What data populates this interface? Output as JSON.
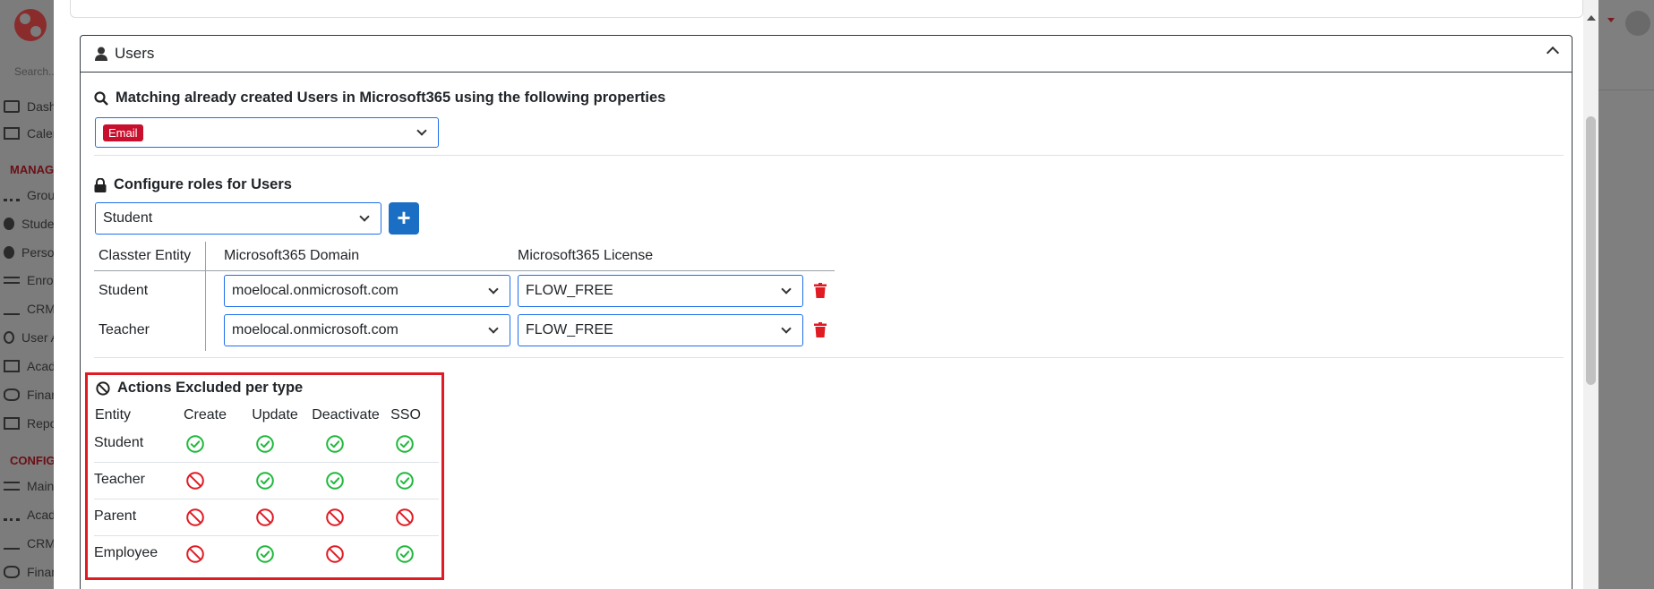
{
  "app": {
    "search_placeholder": "Search...",
    "nav": [
      {
        "label": "Dashboard",
        "icon": "laptop-icon"
      },
      {
        "label": "Calendar",
        "icon": "calendar-icon"
      },
      {
        "label": "Groups",
        "icon": "groups-icon"
      },
      {
        "label": "Students",
        "icon": "students-icon"
      },
      {
        "label": "Persons",
        "icon": "person-icon"
      },
      {
        "label": "Enrollments",
        "icon": "exchange-icon"
      },
      {
        "label": "CRM",
        "icon": "chart-icon"
      },
      {
        "label": "User Access",
        "icon": "key-icon"
      },
      {
        "label": "Academic",
        "icon": "grid-icon"
      },
      {
        "label": "Finance",
        "icon": "coins-icon"
      },
      {
        "label": "Reports",
        "icon": "print-icon"
      },
      {
        "label": "Main Settings",
        "icon": "sliders-icon"
      },
      {
        "label": "Academic Settings",
        "icon": "groups-icon"
      },
      {
        "label": "CRM Settings",
        "icon": "chart-icon"
      },
      {
        "label": "Finance Settings",
        "icon": "coins-icon"
      }
    ],
    "sections": [
      "MANAGE",
      "CONFIG"
    ]
  },
  "card": {
    "title": "Users",
    "matching": {
      "title": "Matching already created Users in Microsoft365 using the following properties",
      "selected_tag": "Email"
    },
    "roles": {
      "title": "Configure roles for Users",
      "selected_role": "Student",
      "add_button": "+",
      "columns": [
        "Classter Entity",
        "Microsoft365 Domain",
        "Microsoft365 License"
      ],
      "rows": [
        {
          "entity": "Student",
          "domain": "moelocal.onmicrosoft.com",
          "license": "FLOW_FREE"
        },
        {
          "entity": "Teacher",
          "domain": "moelocal.onmicrosoft.com",
          "license": "FLOW_FREE"
        }
      ]
    },
    "actions": {
      "title": "Actions Excluded per type",
      "columns": [
        "Entity",
        "Create",
        "Update",
        "Deactivate",
        "SSO"
      ],
      "rows": [
        {
          "entity": "Student",
          "create": "allowed",
          "update": "allowed",
          "deactivate": "allowed",
          "sso": "allowed"
        },
        {
          "entity": "Teacher",
          "create": "excluded",
          "update": "allowed",
          "deactivate": "allowed",
          "sso": "allowed"
        },
        {
          "entity": "Parent",
          "create": "excluded",
          "update": "excluded",
          "deactivate": "excluded",
          "sso": "excluded"
        },
        {
          "entity": "Employee",
          "create": "excluded",
          "update": "allowed",
          "deactivate": "excluded",
          "sso": "allowed"
        }
      ]
    }
  },
  "colors": {
    "allowed": "#1fb83c",
    "excluded": "#e01b24",
    "primary": "#1a6fc4",
    "tag": "#c8102e"
  }
}
